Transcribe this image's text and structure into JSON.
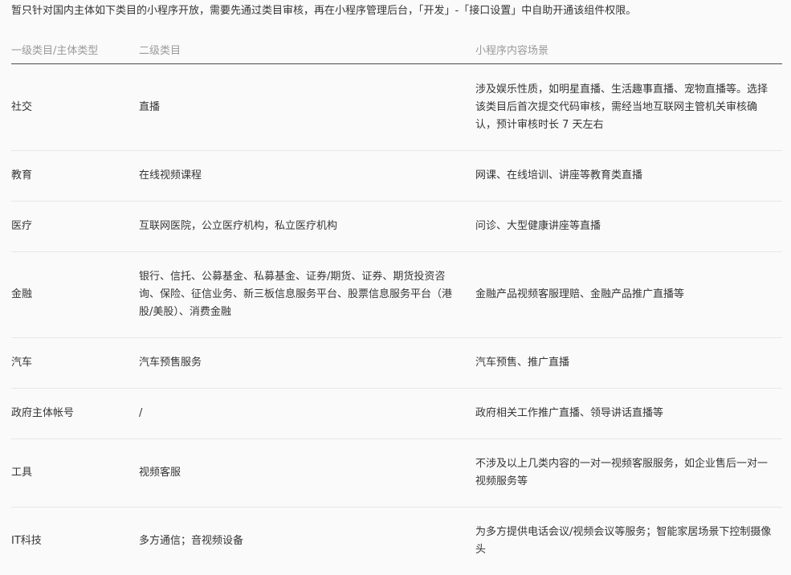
{
  "intro": "暂只针对国内主体如下类目的小程序开放，需要先通过类目审核，再在小程序管理后台，「开发」-「接口设置」中自助开通该组件权限。",
  "table": {
    "headers": [
      "一级类目/主体类型",
      "二级类目",
      "小程序内容场景"
    ],
    "rows": [
      {
        "cat": "社交",
        "sub": "直播",
        "scene": "涉及娱乐性质，如明星直播、生活趣事直播、宠物直播等。选择该类目后首次提交代码审核，需经当地互联网主管机关审核确认，预计审核时长 7 天左右"
      },
      {
        "cat": "教育",
        "sub": "在线视频课程",
        "scene": "网课、在线培训、讲座等教育类直播"
      },
      {
        "cat": "医疗",
        "sub": "互联网医院，公立医疗机构，私立医疗机构",
        "scene": "问诊、大型健康讲座等直播"
      },
      {
        "cat": "金融",
        "sub": "银行、信托、公募基金、私募基金、证券/期货、证券、期货投资咨询、保险、征信业务、新三板信息服务平台、股票信息服务平台（港股/美股）、消费金融",
        "scene": "金融产品视频客服理赔、金融产品推广直播等"
      },
      {
        "cat": "汽车",
        "sub": "汽车预售服务",
        "scene": "汽车预售、推广直播"
      },
      {
        "cat": "政府主体帐号",
        "sub": "/",
        "scene": "政府相关工作推广直播、领导讲话直播等"
      },
      {
        "cat": "工具",
        "sub": "视频客服",
        "scene": "不涉及以上几类内容的一对一视频客服服务，如企业售后一对一视频服务等"
      },
      {
        "cat": "IT科技",
        "sub": "多方通信；音视频设备",
        "scene": "为多方提供电话会议/视频会议等服务；智能家居场景下控制摄像头"
      }
    ]
  }
}
